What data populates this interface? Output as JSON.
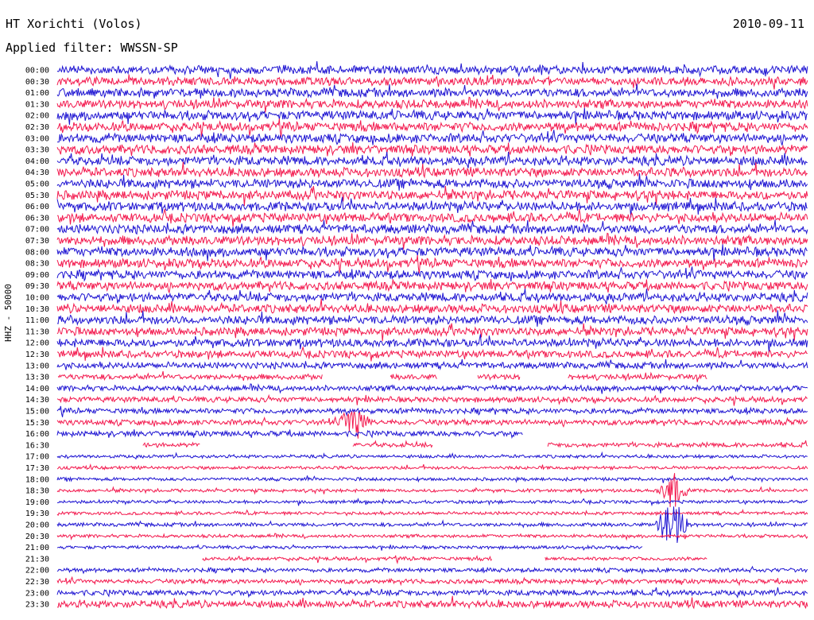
{
  "header": {
    "station": "HT Xorichti (Volos)",
    "date": "2010-09-11",
    "filter": "Applied filter: WWSSN-SP"
  },
  "y_axis_label": "HHZ - 50000",
  "colors": {
    "odd": "#1e14d2",
    "even": "#f3194e"
  },
  "chart_data": {
    "type": "line",
    "title": "HT Xorichti (Volos)",
    "subtitle": "Applied filter: WWSSN-SP",
    "ylabel": "HHZ - 50000",
    "xlabel": "",
    "grid": false,
    "categories": [
      "00:00",
      "00:30",
      "01:00",
      "01:30",
      "02:00",
      "02:30",
      "03:00",
      "03:30",
      "04:00",
      "04:30",
      "05:00",
      "05:30",
      "06:00",
      "06:30",
      "07:00",
      "07:30",
      "08:00",
      "08:30",
      "09:00",
      "09:30",
      "10:00",
      "10:30",
      "11:00",
      "11:30",
      "12:00",
      "12:30",
      "13:00",
      "13:30",
      "14:00",
      "14:30",
      "15:00",
      "15:30",
      "16:00",
      "16:30",
      "17:00",
      "17:30",
      "18:00",
      "18:30",
      "19:00",
      "19:30",
      "20:00",
      "20:30",
      "21:00",
      "21:30",
      "22:00",
      "22:30",
      "23:00",
      "23:30"
    ],
    "trace_minutes": 30,
    "amplitude": [
      0.9,
      0.9,
      0.95,
      0.95,
      1,
      1,
      1,
      1,
      1,
      1,
      1,
      1,
      1,
      1,
      1,
      1,
      1,
      1,
      0.95,
      0.95,
      0.95,
      0.95,
      0.95,
      0.9,
      0.9,
      0.8,
      0.7,
      0.6,
      0.6,
      0.6,
      0.6,
      0.6,
      0.6,
      0.5,
      0.35,
      0.35,
      0.35,
      0.35,
      0.35,
      0.35,
      0.4,
      0.35,
      0.35,
      0.4,
      0.45,
      0.5,
      0.6,
      0.8
    ],
    "gaps": [
      {
        "trace": "13:30",
        "from": 0.0,
        "to": 0.0
      },
      {
        "trace": "13:30",
        "from": 10.6,
        "to": 13.3
      },
      {
        "trace": "13:30",
        "from": 15.2,
        "to": 16.8
      },
      {
        "trace": "13:30",
        "from": 18.5,
        "to": 20.4
      },
      {
        "trace": "13:30",
        "from": 26.0,
        "to": 30.0
      },
      {
        "trace": "16:00",
        "from": 18.6,
        "to": 30.0
      },
      {
        "trace": "16:30",
        "from": 0.0,
        "to": 3.4
      },
      {
        "trace": "16:30",
        "from": 5.7,
        "to": 11.8
      },
      {
        "trace": "16:30",
        "from": 15.0,
        "to": 19.6
      },
      {
        "trace": "21:00",
        "from": 23.4,
        "to": 30.0
      },
      {
        "trace": "21:30",
        "from": 0.0,
        "to": 5.8
      },
      {
        "trace": "21:30",
        "from": 17.4,
        "to": 19.5
      },
      {
        "trace": "21:30",
        "from": 26.0,
        "to": 30.0
      }
    ],
    "events": [
      {
        "trace": "20:00",
        "minute": 24.6,
        "strength": 2.0
      },
      {
        "trace": "18:30",
        "minute": 24.6,
        "strength": 1.3
      },
      {
        "trace": "16:00",
        "minute": 20.4,
        "strength": 1.5
      },
      {
        "trace": "15:30",
        "minute": 11.9,
        "strength": 1.2
      }
    ]
  }
}
